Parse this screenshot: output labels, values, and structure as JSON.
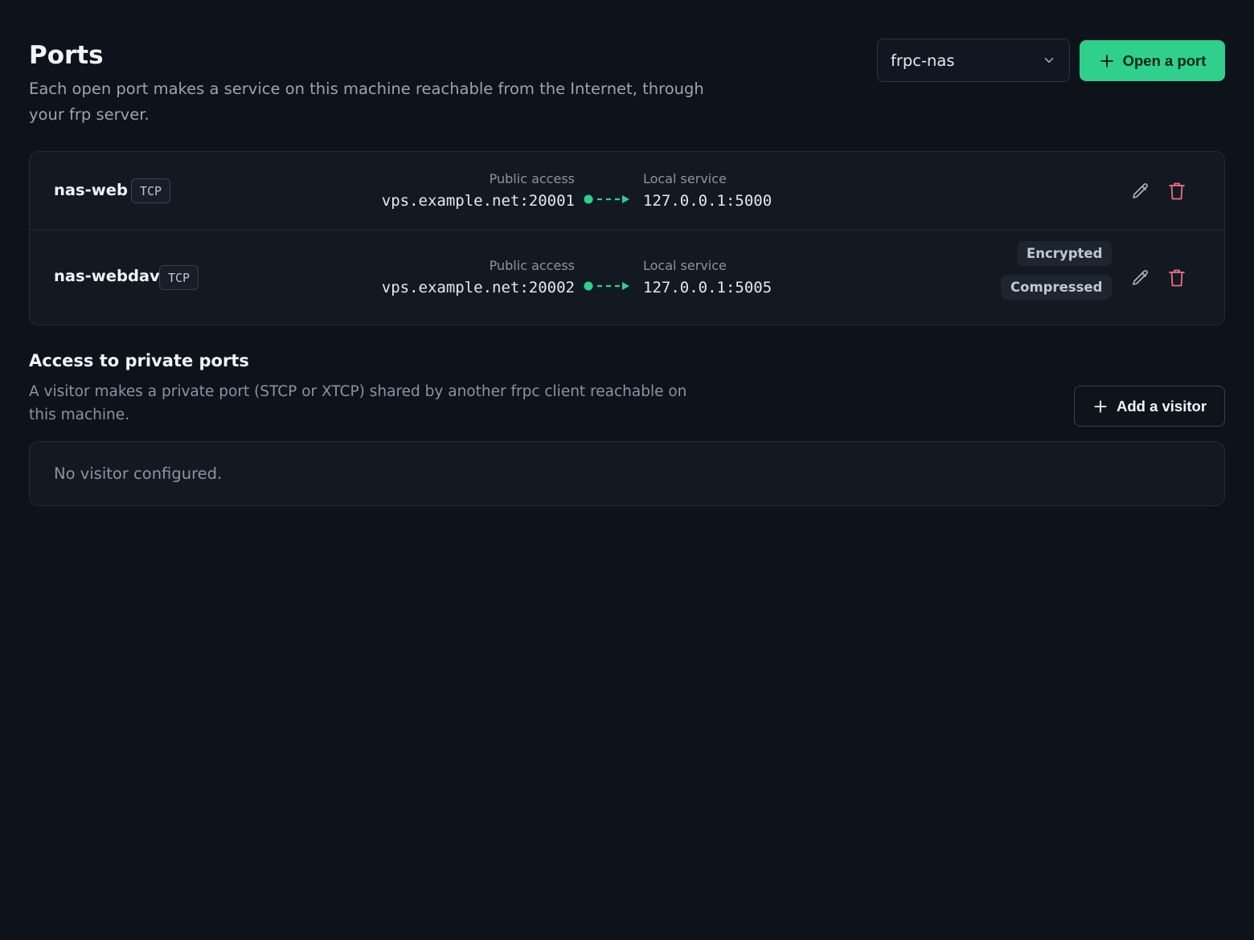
{
  "header": {
    "title": "Ports",
    "description": "Each open port makes a service on this machine reachable from the Internet, through your frp server."
  },
  "client_select": {
    "selected": "frpc-nas"
  },
  "open_port_button": {
    "label": "Open a port"
  },
  "ports": [
    {
      "name": "nas-web",
      "protocol": "TCP",
      "public_label": "Public access",
      "public_value": "vps.example.net:20001",
      "local_label": "Local service",
      "local_value": "127.0.0.1:5000",
      "flags": []
    },
    {
      "name": "nas-webdav",
      "protocol": "TCP",
      "public_label": "Public access",
      "public_value": "vps.example.net:20002",
      "local_label": "Local service",
      "local_value": "127.0.0.1:5005",
      "flags": [
        "Encrypted",
        "Compressed"
      ]
    }
  ],
  "visitors": {
    "title": "Access to private ports",
    "description": "A visitor makes a private port (STCP or XTCP) shared by another frpc client reachable on this machine.",
    "add_button_label": "Add a visitor",
    "empty_text": "No visitor configured."
  },
  "colors": {
    "background": "#0e121a",
    "card": "#131922",
    "accent": "#2fd08b",
    "danger": "#f0707a"
  },
  "icons": {
    "add": "plus-icon",
    "chevron": "chevron-down-icon",
    "edit": "pencil-icon",
    "delete": "trash-icon",
    "arrow": "dashed-arrow-icon"
  }
}
